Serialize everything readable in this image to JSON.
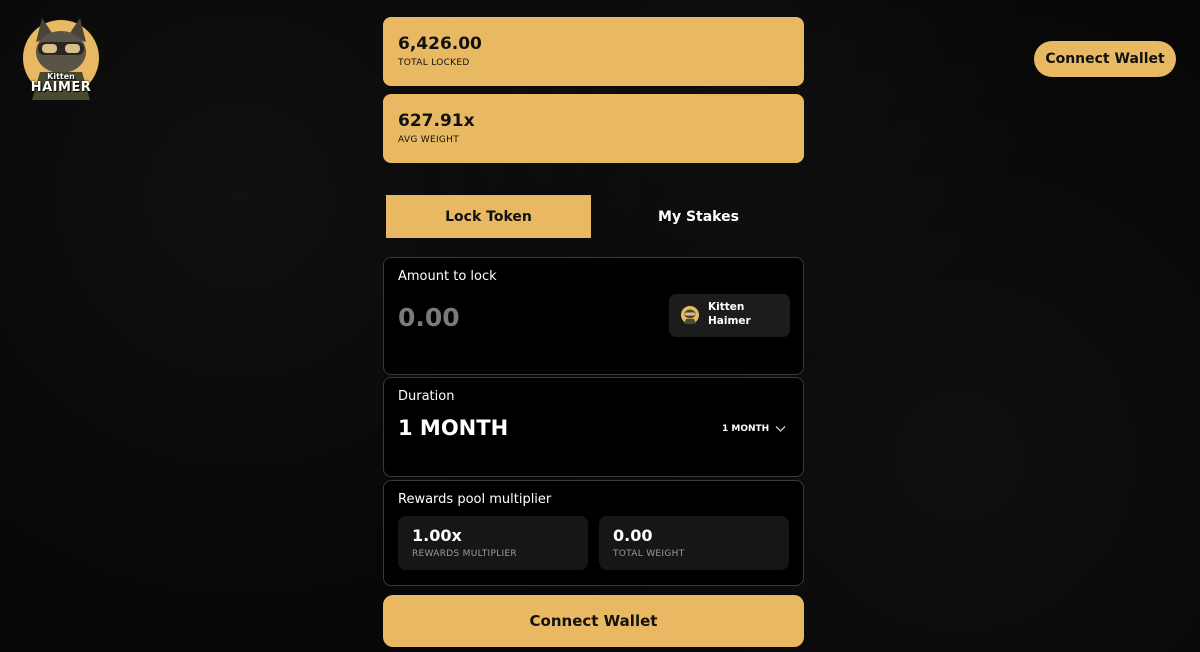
{
  "brand": {
    "logo_line1": "Kitten",
    "logo_line2": "HAIMER",
    "accent": "#e8b962"
  },
  "header": {
    "connect_label": "Connect Wallet"
  },
  "stats": [
    {
      "value": "6,426.00",
      "label": "TOTAL LOCKED"
    },
    {
      "value": "627.91x",
      "label": "AVG WEIGHT"
    }
  ],
  "tabs": [
    {
      "label": "Lock Token",
      "active": true
    },
    {
      "label": "My Stakes",
      "active": false
    }
  ],
  "amount": {
    "title": "Amount to lock",
    "placeholder": "0.00",
    "value": "",
    "token_line1": "Kitten",
    "token_line2": "Haimer",
    "token_icon": "kitten-haimer-token-icon"
  },
  "duration": {
    "title": "Duration",
    "value": "1 MONTH",
    "selected_option": "1 MONTH"
  },
  "rewards": {
    "title": "Rewards pool multiplier",
    "multiplier_value": "1.00x",
    "multiplier_label": "REWARDS MULTIPLIER",
    "weight_value": "0.00",
    "weight_label": "TOTAL WEIGHT"
  },
  "footer": {
    "connect_label": "Connect Wallet"
  }
}
